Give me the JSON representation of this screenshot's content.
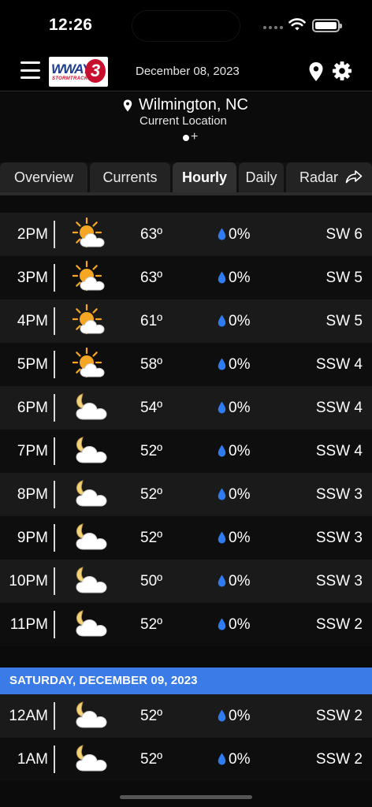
{
  "status_bar": {
    "time": "12:26"
  },
  "header": {
    "logo_text": "WWAY",
    "logo_sub": "STORMTRACK",
    "logo_mark": "3",
    "date": "December 08, 2023"
  },
  "location": {
    "name": "Wilmington, NC",
    "sub": "Current Location",
    "add": "+"
  },
  "tabs": [
    {
      "label": "Overview"
    },
    {
      "label": "Currents"
    },
    {
      "label": "Hourly",
      "active": true
    },
    {
      "label": "Daily"
    },
    {
      "label": "Radar"
    }
  ],
  "hours_today": [
    {
      "time": "2PM",
      "icon": "partly-sunny-icon",
      "temp": "63º",
      "precip": "0%",
      "wind": "SW 6"
    },
    {
      "time": "3PM",
      "icon": "partly-sunny-icon",
      "temp": "63º",
      "precip": "0%",
      "wind": "SW 5"
    },
    {
      "time": "4PM",
      "icon": "partly-sunny-icon",
      "temp": "61º",
      "precip": "0%",
      "wind": "SW 5"
    },
    {
      "time": "5PM",
      "icon": "partly-sunny-icon",
      "temp": "58º",
      "precip": "0%",
      "wind": "SSW 4"
    },
    {
      "time": "6PM",
      "icon": "partly-cloudy-night-icon",
      "temp": "54º",
      "precip": "0%",
      "wind": "SSW 4"
    },
    {
      "time": "7PM",
      "icon": "partly-cloudy-night-icon",
      "temp": "52º",
      "precip": "0%",
      "wind": "SSW 4"
    },
    {
      "time": "8PM",
      "icon": "partly-cloudy-night-icon",
      "temp": "52º",
      "precip": "0%",
      "wind": "SSW 3"
    },
    {
      "time": "9PM",
      "icon": "partly-cloudy-night-icon",
      "temp": "52º",
      "precip": "0%",
      "wind": "SSW 3"
    },
    {
      "time": "10PM",
      "icon": "partly-cloudy-night-icon",
      "temp": "50º",
      "precip": "0%",
      "wind": "SSW 3"
    },
    {
      "time": "11PM",
      "icon": "partly-cloudy-night-icon",
      "temp": "52º",
      "precip": "0%",
      "wind": "SSW 2"
    }
  ],
  "day_header": "SATURDAY, DECEMBER 09, 2023",
  "hours_tomorrow": [
    {
      "time": "12AM",
      "icon": "partly-cloudy-night-icon",
      "temp": "52º",
      "precip": "0%",
      "wind": "SSW 2"
    },
    {
      "time": "1AM",
      "icon": "partly-cloudy-night-icon",
      "temp": "52º",
      "precip": "0%",
      "wind": "SSW 2"
    }
  ],
  "colors": {
    "accent_blue": "#3b7be8",
    "drop_blue": "#2f7bf0",
    "sun_orange": "#f5a623"
  }
}
